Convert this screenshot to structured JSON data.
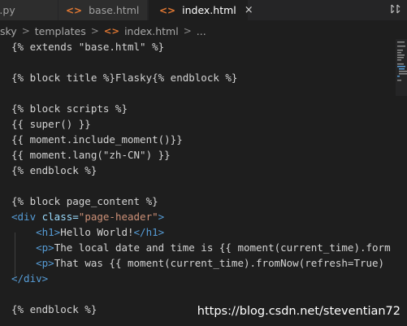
{
  "tabs": [
    {
      "label": "o.py"
    },
    {
      "label": "base.html",
      "icon": "<>"
    },
    {
      "label": "index.html",
      "icon": "<>",
      "close": "×"
    }
  ],
  "breadcrumb": {
    "items": [
      "sky",
      "templates",
      "index.html",
      "..."
    ],
    "file_icon": "<>",
    "separator": ">"
  },
  "code_lines": [
    "{% extends \"base.html\" %}",
    "",
    "{% block title %}Flasky{% endblock %}",
    "",
    "{% block scripts %}",
    "{{ super() }}",
    "{{ moment.include_moment()}}",
    "{{ moment.lang(\"zh-CN\") }}",
    "{% endblock %}",
    "",
    "{% block page_content %}",
    {
      "tag_open": "<div",
      "attr": " class=",
      "value": "\"page-header\"",
      "close": ">"
    },
    {
      "indent": "    ",
      "open": "<h1>",
      "text": "Hello World!",
      "end": "</h1>"
    },
    {
      "indent": "    ",
      "open": "<p>",
      "text": "The local date and time is {{ moment(current_time).form"
    },
    {
      "indent": "    ",
      "open": "<p>",
      "text": "That was {{ moment(current_time).fromNow(refresh=True)"
    },
    {
      "end": "</div>"
    },
    "",
    "{% endblock %}"
  ],
  "watermark": "https://blog.csdn.net/steventian72",
  "colors": {
    "background": "#1e1e1e",
    "tag": "#569cd6",
    "attribute": "#9cdcfe",
    "string": "#ce9178",
    "html_icon": "#e37933"
  }
}
